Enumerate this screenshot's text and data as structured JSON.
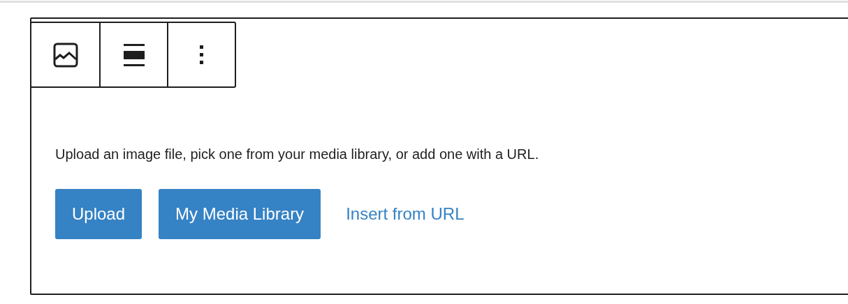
{
  "block": {
    "description": "Upload an image file, pick one from your media library, or add one with a URL.",
    "buttons": [
      {
        "label": "Upload",
        "kind": "primary"
      },
      {
        "label": "My Media Library",
        "kind": "primary"
      },
      {
        "label": "Insert from URL",
        "kind": "link"
      }
    ]
  },
  "toolbar": [
    {
      "kind": "image"
    },
    {
      "kind": "align"
    },
    {
      "kind": "more"
    }
  ]
}
